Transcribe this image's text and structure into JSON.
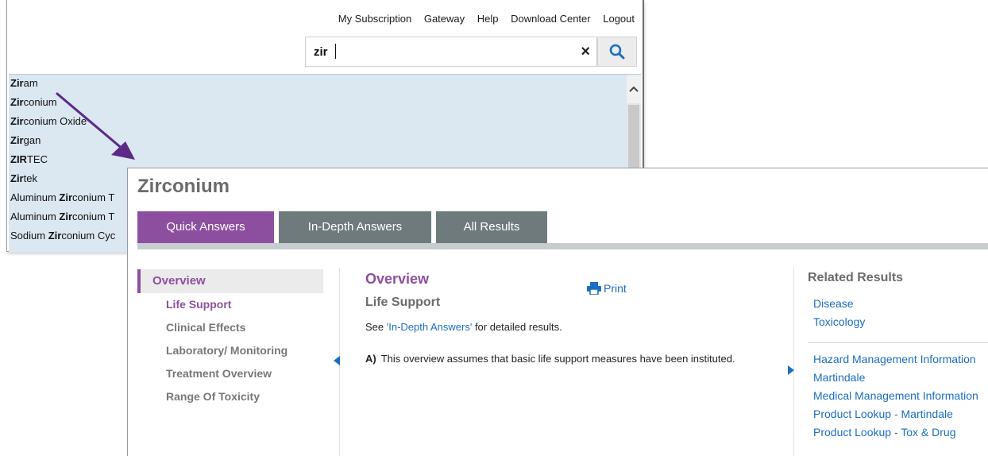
{
  "topnav": {
    "subscription": "My Subscription",
    "gateway": "Gateway",
    "help": "Help",
    "download": "Download Center",
    "logout": "Logout"
  },
  "search": {
    "value": "zir",
    "clear_symbol": "×"
  },
  "suggestions": [
    {
      "match": "Zir",
      "rest": "am",
      "prefix": ""
    },
    {
      "match": "Zir",
      "rest": "conium",
      "prefix": ""
    },
    {
      "match": "Zir",
      "rest": "conium Oxide",
      "prefix": ""
    },
    {
      "match": "Zir",
      "rest": "gan",
      "prefix": ""
    },
    {
      "match": "ZIR",
      "rest": "TEC",
      "prefix": ""
    },
    {
      "match": "Zir",
      "rest": "tek",
      "prefix": ""
    },
    {
      "match": "Zir",
      "rest": "conium T",
      "prefix": "Aluminum "
    },
    {
      "match": "Zir",
      "rest": "conium T",
      "prefix": "Aluminum "
    },
    {
      "match": "Zir",
      "rest": "conium Cyc",
      "prefix": "Sodium "
    }
  ],
  "document": {
    "title": "Zirconium",
    "tabs": [
      "Quick Answers",
      "In-Depth Answers",
      "All Results"
    ]
  },
  "leftnav": {
    "overview": "Overview",
    "items": [
      "Life Support",
      "Clinical Effects",
      "Laboratory/ Monitoring",
      "Treatment Overview",
      "Range Of Toxicity"
    ]
  },
  "content": {
    "title": "Overview",
    "subtitle": "Life Support",
    "see_prefix": "See ",
    "see_link": "'In-Depth Answers'",
    "see_suffix": " for detailed results.",
    "para_label": "A)",
    "para_text": "This overview assumes that basic life support measures have been instituted.",
    "print": "Print"
  },
  "related": {
    "title": "Related Results",
    "group1": [
      "Disease",
      "Toxicology"
    ],
    "group2": [
      "Hazard Management Information",
      "Martindale",
      "Medical Management Information",
      "Product Lookup - Martindale",
      "Product Lookup - Tox & Drug"
    ]
  },
  "colors": {
    "accent_purple": "#8c4f9f",
    "tab_gray": "#6f7a7c",
    "link_blue": "#1b6ec2",
    "arrow": "#5b2a86"
  },
  "icons": {
    "search": "magnifier-icon",
    "print": "printer-icon",
    "left": "triangle-left-icon",
    "right": "triangle-right-icon"
  }
}
